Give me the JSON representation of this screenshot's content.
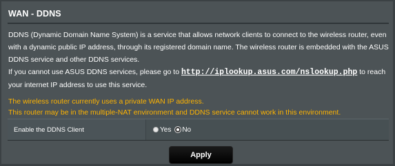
{
  "page": {
    "title": "WAN - DDNS",
    "description": {
      "para1": "DDNS (Dynamic Domain Name System) is a service that allows network clients to connect to the wireless router, even with a dynamic public IP address, through its registered domain name. The wireless router is embedded with the ASUS DDNS service and other DDNS services.",
      "para2_prefix": "If you cannot use ASUS DDNS services, please go to ",
      "para2_link": "http://iplookup.asus.com/nslookup.php",
      "para2_suffix": " to reach your internet IP address to use this service."
    },
    "warnings": {
      "line1": "The wireless router currently uses a private WAN IP address.",
      "line2": "This router may be in the multiple-NAT environment and DDNS service cannot work in this environment."
    },
    "colors": {
      "warning": "#ffb400",
      "background": "#4c5356"
    }
  },
  "settings": {
    "ddns_label": "Enable the DDNS Client",
    "option_yes": "Yes",
    "option_no": "No",
    "selected": "No"
  },
  "actions": {
    "apply_label": "Apply"
  }
}
